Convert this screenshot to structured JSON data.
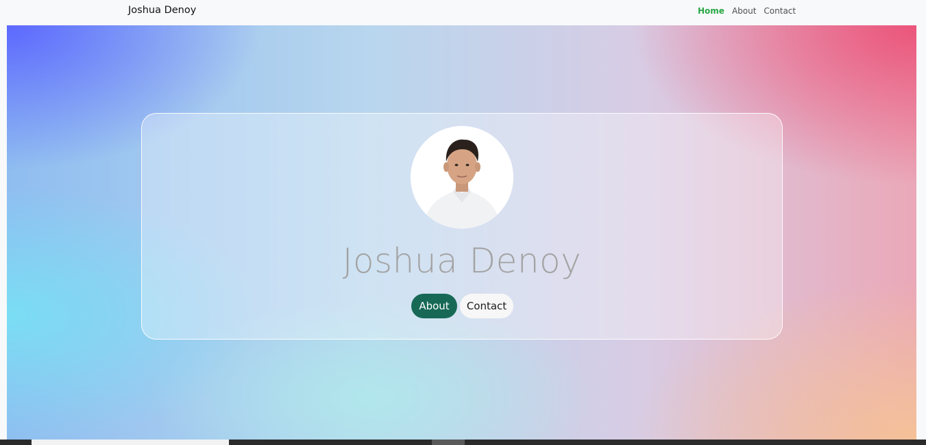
{
  "navbar": {
    "brand": "Joshua Denoy",
    "links": [
      {
        "label": "Home",
        "active": true
      },
      {
        "label": "About",
        "active": false
      },
      {
        "label": "Contact",
        "active": false
      }
    ]
  },
  "hero": {
    "name": "Joshua Denoy",
    "avatar_icon": "profile-photo",
    "buttons": {
      "about": "About",
      "contact": "Contact"
    }
  },
  "colors": {
    "nav_active": "#28a745",
    "primary_button": "#176956",
    "name_text": "#a3a3a3"
  }
}
